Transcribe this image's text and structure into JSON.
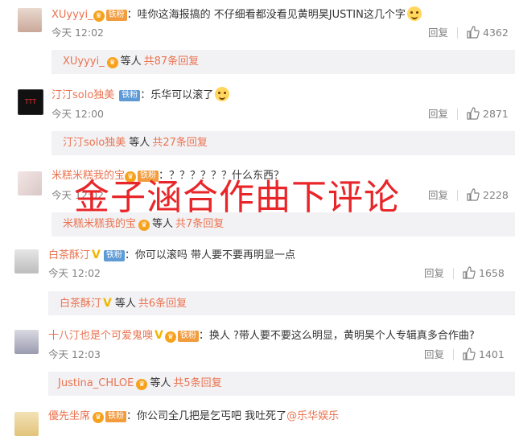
{
  "comments": [
    {
      "username": "XUyyyi_",
      "fan_badge": "铁粉",
      "content": "：哇你这海报搞的 不仔细看都没看见黄明昊JUSTIN这几个字",
      "time": "今天 12:02",
      "reply_label": "回复",
      "likes": "4362",
      "sub_user": "XUyyyi_",
      "sub_mid": "等人",
      "sub_count": "共87条回复"
    },
    {
      "username": "汀汀solo独美",
      "fan_badge": "铁粉",
      "content": "：乐华可以滚了",
      "time": "今天 12:00",
      "reply_label": "回复",
      "likes": "2871",
      "sub_user": "汀汀solo独美",
      "sub_mid": "等人",
      "sub_count": "共27条回复"
    },
    {
      "username": "米糕米糕我的宝",
      "fan_badge": "铁粉",
      "content": "：？？？？？？什么东西？",
      "time": "今天 12:02",
      "reply_label": "回复",
      "likes": "2228",
      "sub_user": "米糕米糕我的宝",
      "sub_mid": "等人",
      "sub_count": "共7条回复"
    },
    {
      "username": "白茶酥汀",
      "fan_badge": "铁粉",
      "content": "：你可以滚吗 带人要不要再明显一点",
      "time": "今天 12:02",
      "reply_label": "回复",
      "likes": "1658",
      "sub_user": "白茶酥汀",
      "sub_mid": "等人",
      "sub_count": "共6条回复"
    },
    {
      "username": "十八汀也是个可爱鬼噢",
      "fan_badge": "铁粉",
      "content": "：换人 ?带人要不要这么明显，黄明昊个人专辑真多合作曲?",
      "time": "今天 12:03",
      "reply_label": "回复",
      "likes": "1401",
      "sub_user": "Justina_CHLOE",
      "sub_mid": "等人",
      "sub_count": "共5条回复"
    },
    {
      "username": "優先坐席",
      "fan_badge": "铁粉",
      "content": "：你公司全几把是乞丐吧 我吐死了",
      "mention": "@乐华娱乐"
    }
  ],
  "overlay_text": "金子涵合作曲下评论",
  "colors": {
    "username": "#eb7350",
    "overlay": "#e8262a",
    "sub_bg": "#f2f2f5"
  },
  "icons": {
    "vip": "vip-crown-icon",
    "like": "thumbs-up-icon",
    "emoji": "smile-emoji-icon"
  }
}
